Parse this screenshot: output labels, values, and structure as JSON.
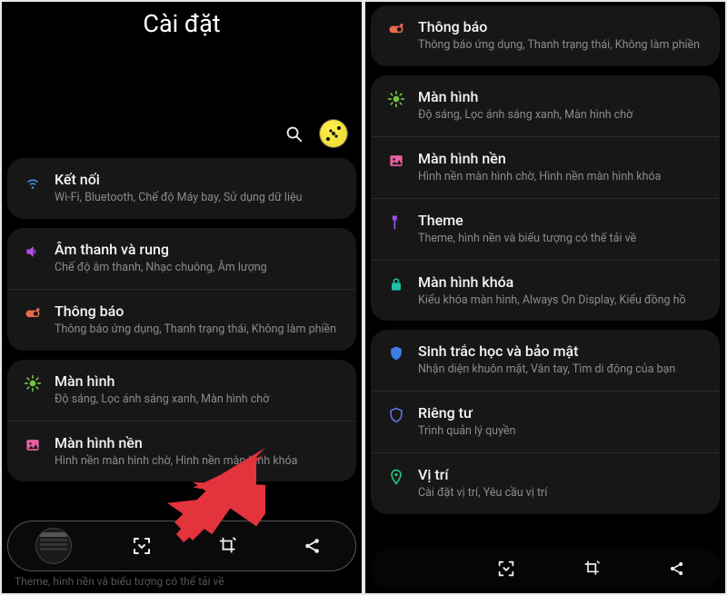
{
  "left": {
    "title": "Cài đặt",
    "groups": [
      {
        "items": [
          {
            "id": "connections",
            "icon": "wifi",
            "color": "#3f8ee6",
            "title": "Kết nối",
            "sub": "Wi-Fi, Bluetooth, Chế độ Máy bay, Sử dụng dữ liệu"
          }
        ]
      },
      {
        "items": [
          {
            "id": "sound",
            "icon": "speaker",
            "color": "#b34de0",
            "title": "Âm thanh và rung",
            "sub": "Chế độ âm thanh, Nhạc chuông, Âm lượng"
          },
          {
            "id": "notifications",
            "icon": "toggle",
            "color": "#ea6a4e",
            "title": "Thông báo",
            "sub": "Thông báo ứng dụng, Thanh trạng thái, Không làm phiền"
          }
        ]
      },
      {
        "items": [
          {
            "id": "display",
            "icon": "brightness",
            "color": "#73c23f",
            "title": "Màn hình",
            "sub": "Độ sáng, Lọc ánh sáng xanh, Màn hình chờ"
          },
          {
            "id": "wallpaper",
            "icon": "image",
            "color": "#e85fa1",
            "title": "Màn hình nền",
            "sub": "Hình nền màn hình chờ, Hình nền màn hình khóa"
          }
        ]
      }
    ],
    "ghost": "Theme, hình nền và biểu tượng có thể tải về"
  },
  "right": {
    "groups": [
      {
        "items": [
          {
            "id": "notifications",
            "icon": "toggle",
            "color": "#ea6a4e",
            "title": "Thông báo",
            "sub": "Thông báo ứng dụng, Thanh trạng thái, Không làm phiền"
          }
        ]
      },
      {
        "items": [
          {
            "id": "display",
            "icon": "brightness",
            "color": "#73c23f",
            "title": "Màn hình",
            "sub": "Độ sáng, Lọc ánh sáng xanh, Màn hình chờ"
          },
          {
            "id": "wallpaper",
            "icon": "image",
            "color": "#e85fa1",
            "title": "Màn hình nền",
            "sub": "Hình nền màn hình chờ, Hình nền màn hình khóa"
          },
          {
            "id": "theme",
            "icon": "brush",
            "color": "#9a50e8",
            "title": "Theme",
            "sub": "Theme, hình nền và biểu tượng có thể tải về"
          },
          {
            "id": "lockscreen",
            "icon": "lock",
            "color": "#1fbfa8",
            "title": "Màn hình khóa",
            "sub": "Kiểu khóa màn hình, Always On Display, Kiểu đồng hồ"
          }
        ]
      },
      {
        "items": [
          {
            "id": "biometrics",
            "icon": "shield",
            "color": "#3f7de6",
            "title": "Sinh trắc học và bảo mật",
            "sub": "Nhận diện khuôn mặt, Vân tay, Tìm di động của bạn"
          },
          {
            "id": "privacy",
            "icon": "shield-outline",
            "color": "#5a6fe6",
            "title": "Riêng tư",
            "sub": "Trình quản lý quyền"
          },
          {
            "id": "location",
            "icon": "pin",
            "color": "#1fc27a",
            "title": "Vị trí",
            "sub": "Cài đặt vị trí, Yêu cầu vị trí"
          }
        ]
      }
    ]
  }
}
